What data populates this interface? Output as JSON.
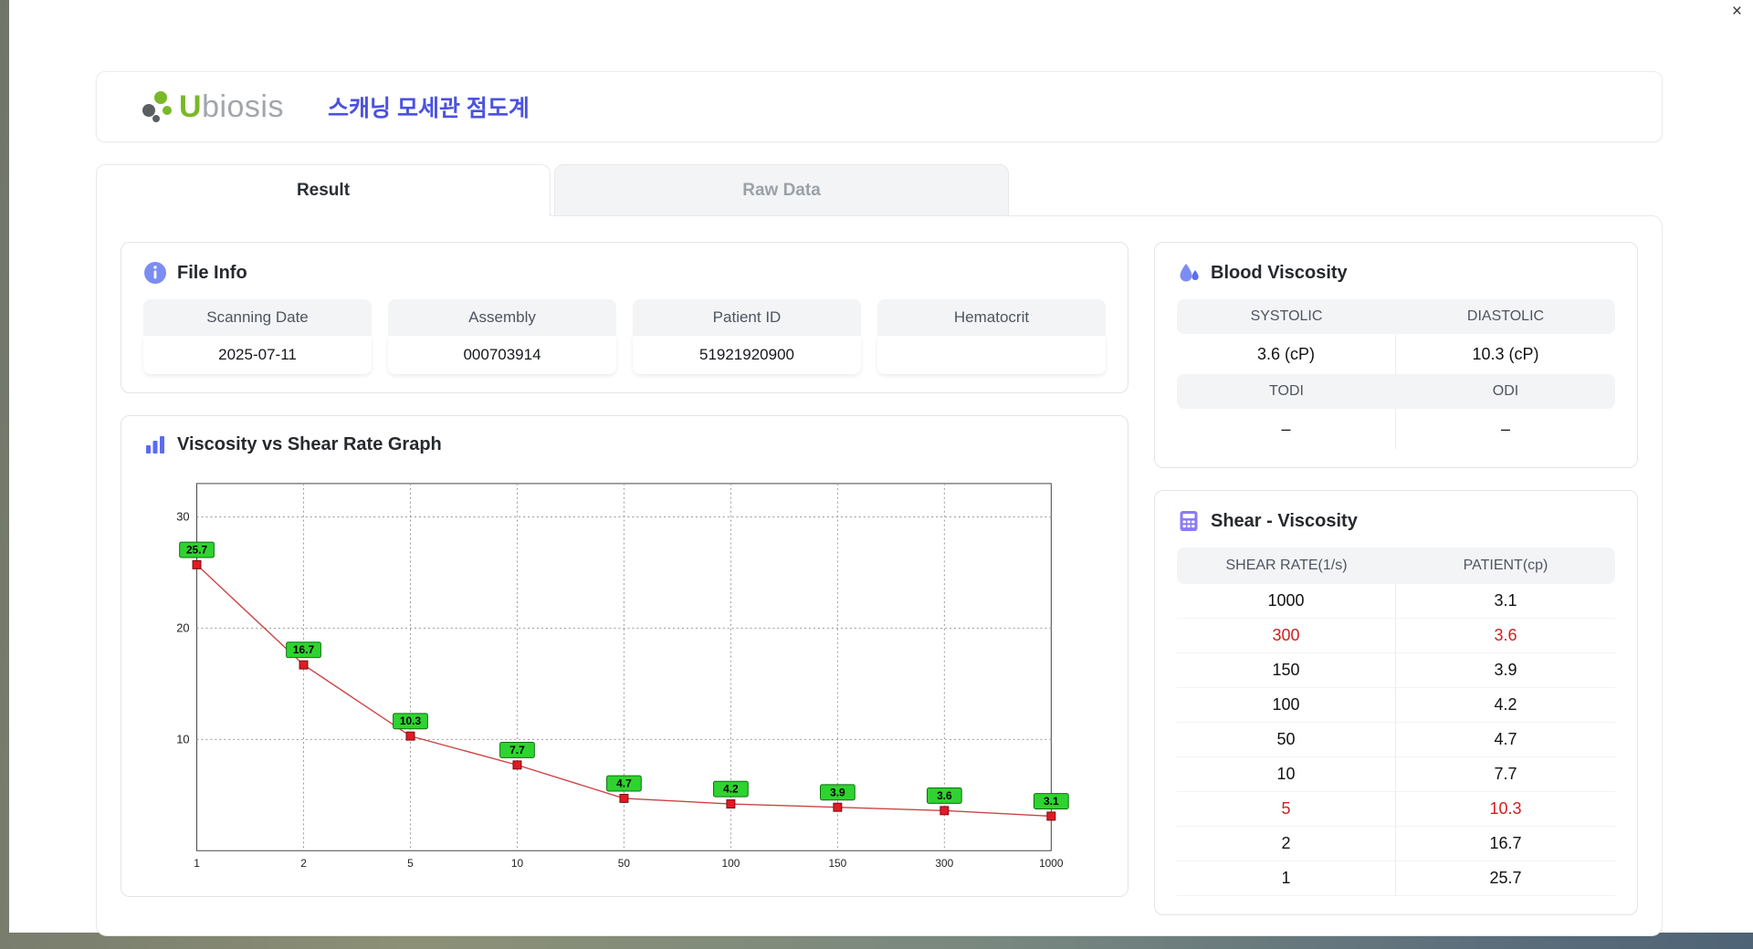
{
  "window": {
    "close_label": "×"
  },
  "header": {
    "brand_u": "U",
    "brand_rest": "biosis",
    "title": "스캐닝 모세관 점도계",
    "brand_green": "#79b928",
    "title_color": "#4a52e0"
  },
  "tabs": [
    {
      "label": "Result",
      "active": true
    },
    {
      "label": "Raw Data",
      "active": false
    }
  ],
  "file_info": {
    "icon": "info-icon",
    "heading": "File Info",
    "fields": [
      {
        "label": "Scanning Date",
        "value": "2025-07-11"
      },
      {
        "label": "Assembly",
        "value": "000703914"
      },
      {
        "label": "Patient ID",
        "value": "51921920900"
      },
      {
        "label": "Hematocrit",
        "value": ""
      }
    ]
  },
  "graph": {
    "icon": "bar-chart-icon",
    "heading": "Viscosity vs Shear Rate Graph"
  },
  "blood_viscosity": {
    "icon": "droplet-icon",
    "heading": "Blood Viscosity",
    "rows": [
      {
        "labels": [
          "SYSTOLIC",
          "DIASTOLIC"
        ],
        "values": [
          "3.6 (cP)",
          "10.3 (cP)"
        ]
      },
      {
        "labels": [
          "TODI",
          "ODI"
        ],
        "values": [
          "–",
          "–"
        ]
      }
    ]
  },
  "shear_viscosity": {
    "icon": "calculator-icon",
    "heading": "Shear - Viscosity",
    "columns": [
      "SHEAR RATE(1/s)",
      "PATIENT(cp)"
    ],
    "rows": [
      {
        "shear": "1000",
        "patient": "3.1",
        "highlight": false
      },
      {
        "shear": "300",
        "patient": "3.6",
        "highlight": true
      },
      {
        "shear": "150",
        "patient": "3.9",
        "highlight": false
      },
      {
        "shear": "100",
        "patient": "4.2",
        "highlight": false
      },
      {
        "shear": "50",
        "patient": "4.7",
        "highlight": false
      },
      {
        "shear": "10",
        "patient": "7.7",
        "highlight": false
      },
      {
        "shear": "5",
        "patient": "10.3",
        "highlight": true
      },
      {
        "shear": "2",
        "patient": "16.7",
        "highlight": false
      },
      {
        "shear": "1",
        "patient": "25.7",
        "highlight": false
      }
    ],
    "highlight_color": "#d01f1f"
  },
  "chart_data": {
    "type": "line",
    "title": "Viscosity vs Shear Rate Graph",
    "categories": [
      "1",
      "2",
      "5",
      "10",
      "50",
      "100",
      "150",
      "300",
      "1000"
    ],
    "values": [
      25.7,
      16.7,
      10.3,
      7.7,
      4.7,
      4.2,
      3.9,
      3.6,
      3.1
    ],
    "xlabel": "",
    "ylabel": "",
    "yticks": [
      10,
      20,
      30
    ],
    "ylim": [
      0,
      33
    ],
    "grid": true,
    "legend": false,
    "line_color": "#cc4444",
    "marker_color": "#e01b24",
    "marker_border": "#7a0a10",
    "label_bg": "#2fd32f",
    "label_border": "#0c700c"
  }
}
